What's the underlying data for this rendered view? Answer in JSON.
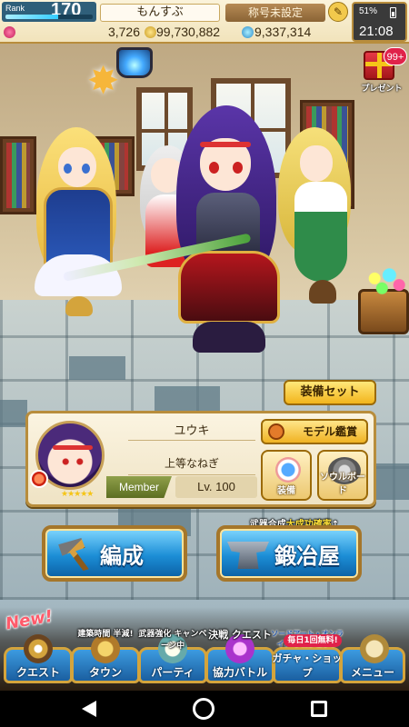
{
  "status": {
    "rank_label": "Rank",
    "rank_value": "170",
    "rank_progress": 0.6,
    "player_name": "もんすぶ",
    "player_title": "称号未設定",
    "battery": "51%",
    "clock": "21:08"
  },
  "currency": {
    "gems": "3,726",
    "coins": "99,730,882",
    "crystals": "9,337,314"
  },
  "present": {
    "badge": "99+",
    "label": "プレゼント"
  },
  "equip_set_label": "装備セット",
  "character": {
    "name": "ユウキ",
    "title": "上等なねぎ",
    "member_tag": "Member",
    "level": "Lv.  100",
    "stars": "★★★★★",
    "model_button": "モデル鑑賞",
    "equip_button": "装備",
    "soulboard_button": "ソウルボード"
  },
  "main_buttons": {
    "formation": "編成",
    "smithy": "鍛冶屋",
    "smithy_banner_prefix": "武器合成",
    "smithy_banner_highlight": "大成功確率",
    "smithy_banner_suffix": "↑"
  },
  "nav": {
    "quest": {
      "label": "クエスト",
      "tag": "New!"
    },
    "town": {
      "label": "タウン",
      "tag": "建築時間 半減!"
    },
    "party": {
      "label": "パーティ",
      "tag": "武器強化 キャンペーン中"
    },
    "coop": {
      "label": "協力バトル",
      "tag": "決戦 クエスト"
    },
    "gacha": {
      "label": "ガチャ・ショップ",
      "tag": "ソードアート・オンライン プロジェクト",
      "free": "毎日1回無料!"
    },
    "menu": {
      "label": "メニュー"
    }
  },
  "colors": {
    "accent_gold": "#f2b51c",
    "nav_blue": "#1b5fa0",
    "badge_red": "#e0224a"
  }
}
